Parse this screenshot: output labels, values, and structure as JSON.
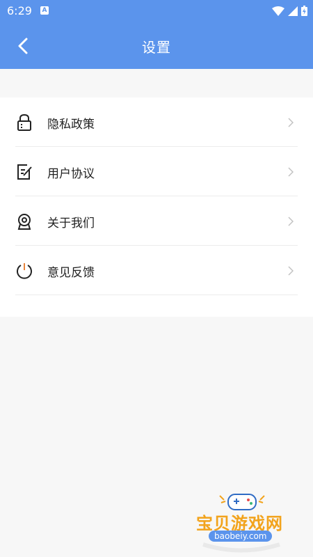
{
  "status_bar": {
    "time": "6:29",
    "notification_icon": "A"
  },
  "header": {
    "title": "设置"
  },
  "menu": [
    {
      "label": "隐私政策",
      "icon": "lock-icon"
    },
    {
      "label": "用户协议",
      "icon": "document-edit-icon"
    },
    {
      "label": "关于我们",
      "icon": "about-badge-icon"
    },
    {
      "label": "意见反馈",
      "icon": "power-icon"
    }
  ],
  "watermark": {
    "name": "宝贝游戏网",
    "url": "baobeiy.com"
  },
  "colors": {
    "primary": "#5b94ec",
    "background": "#f7f7f7",
    "text": "#222222"
  }
}
